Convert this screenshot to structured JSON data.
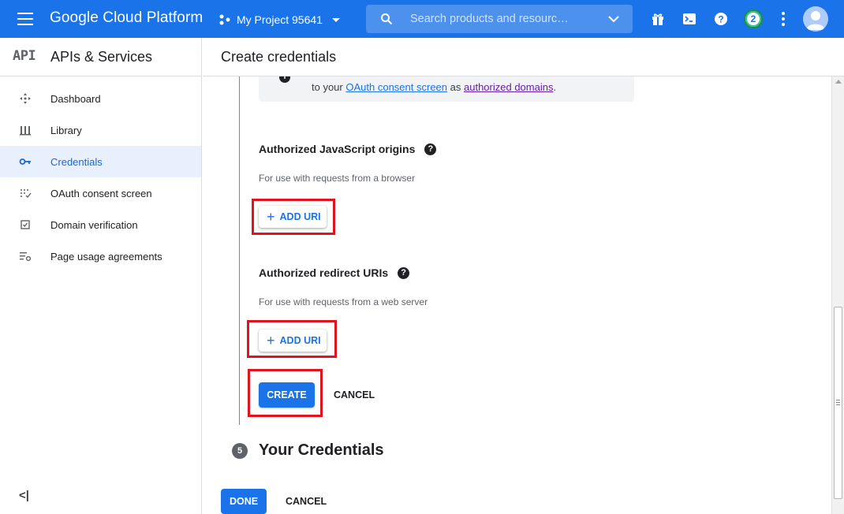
{
  "topbar": {
    "brand": "Google Cloud Platform",
    "project_name": "My Project 95641",
    "search_placeholder": "Search products and resourc…",
    "notification_count": "2"
  },
  "sidebar": {
    "logo": "API",
    "title": "APIs & Services",
    "items": [
      {
        "label": "Dashboard",
        "icon": "dashboard-icon"
      },
      {
        "label": "Library",
        "icon": "library-icon"
      },
      {
        "label": "Credentials",
        "icon": "key-icon",
        "active": true
      },
      {
        "label": "OAuth consent screen",
        "icon": "consent-grid-icon"
      },
      {
        "label": "Domain verification",
        "icon": "checkbox-icon"
      },
      {
        "label": "Page usage agreements",
        "icon": "settings-list-icon"
      }
    ],
    "collapse_label": "<|"
  },
  "main": {
    "title": "Create credentials",
    "info": {
      "prefix": "to your",
      "link1": "OAuth consent screen",
      "middle": "as",
      "link2": "authorized domains",
      "suffix": "."
    },
    "js_origins": {
      "title": "Authorized JavaScript origins",
      "description": "For use with requests from a browser",
      "add_label": "ADD URI"
    },
    "redirect_uris": {
      "title": "Authorized redirect URIs",
      "description": "For use with requests from a web server",
      "add_label": "ADD URI"
    },
    "create_label": "CREATE",
    "cancel_label": "CANCEL",
    "step": {
      "number": "5",
      "title": "Your Credentials"
    },
    "done_label": "DONE",
    "cancel2_label": "CANCEL"
  },
  "colors": {
    "brand_blue": "#1a73e8",
    "highlight_red": "#e0141e",
    "active_nav_bg": "#e8f0fe"
  }
}
